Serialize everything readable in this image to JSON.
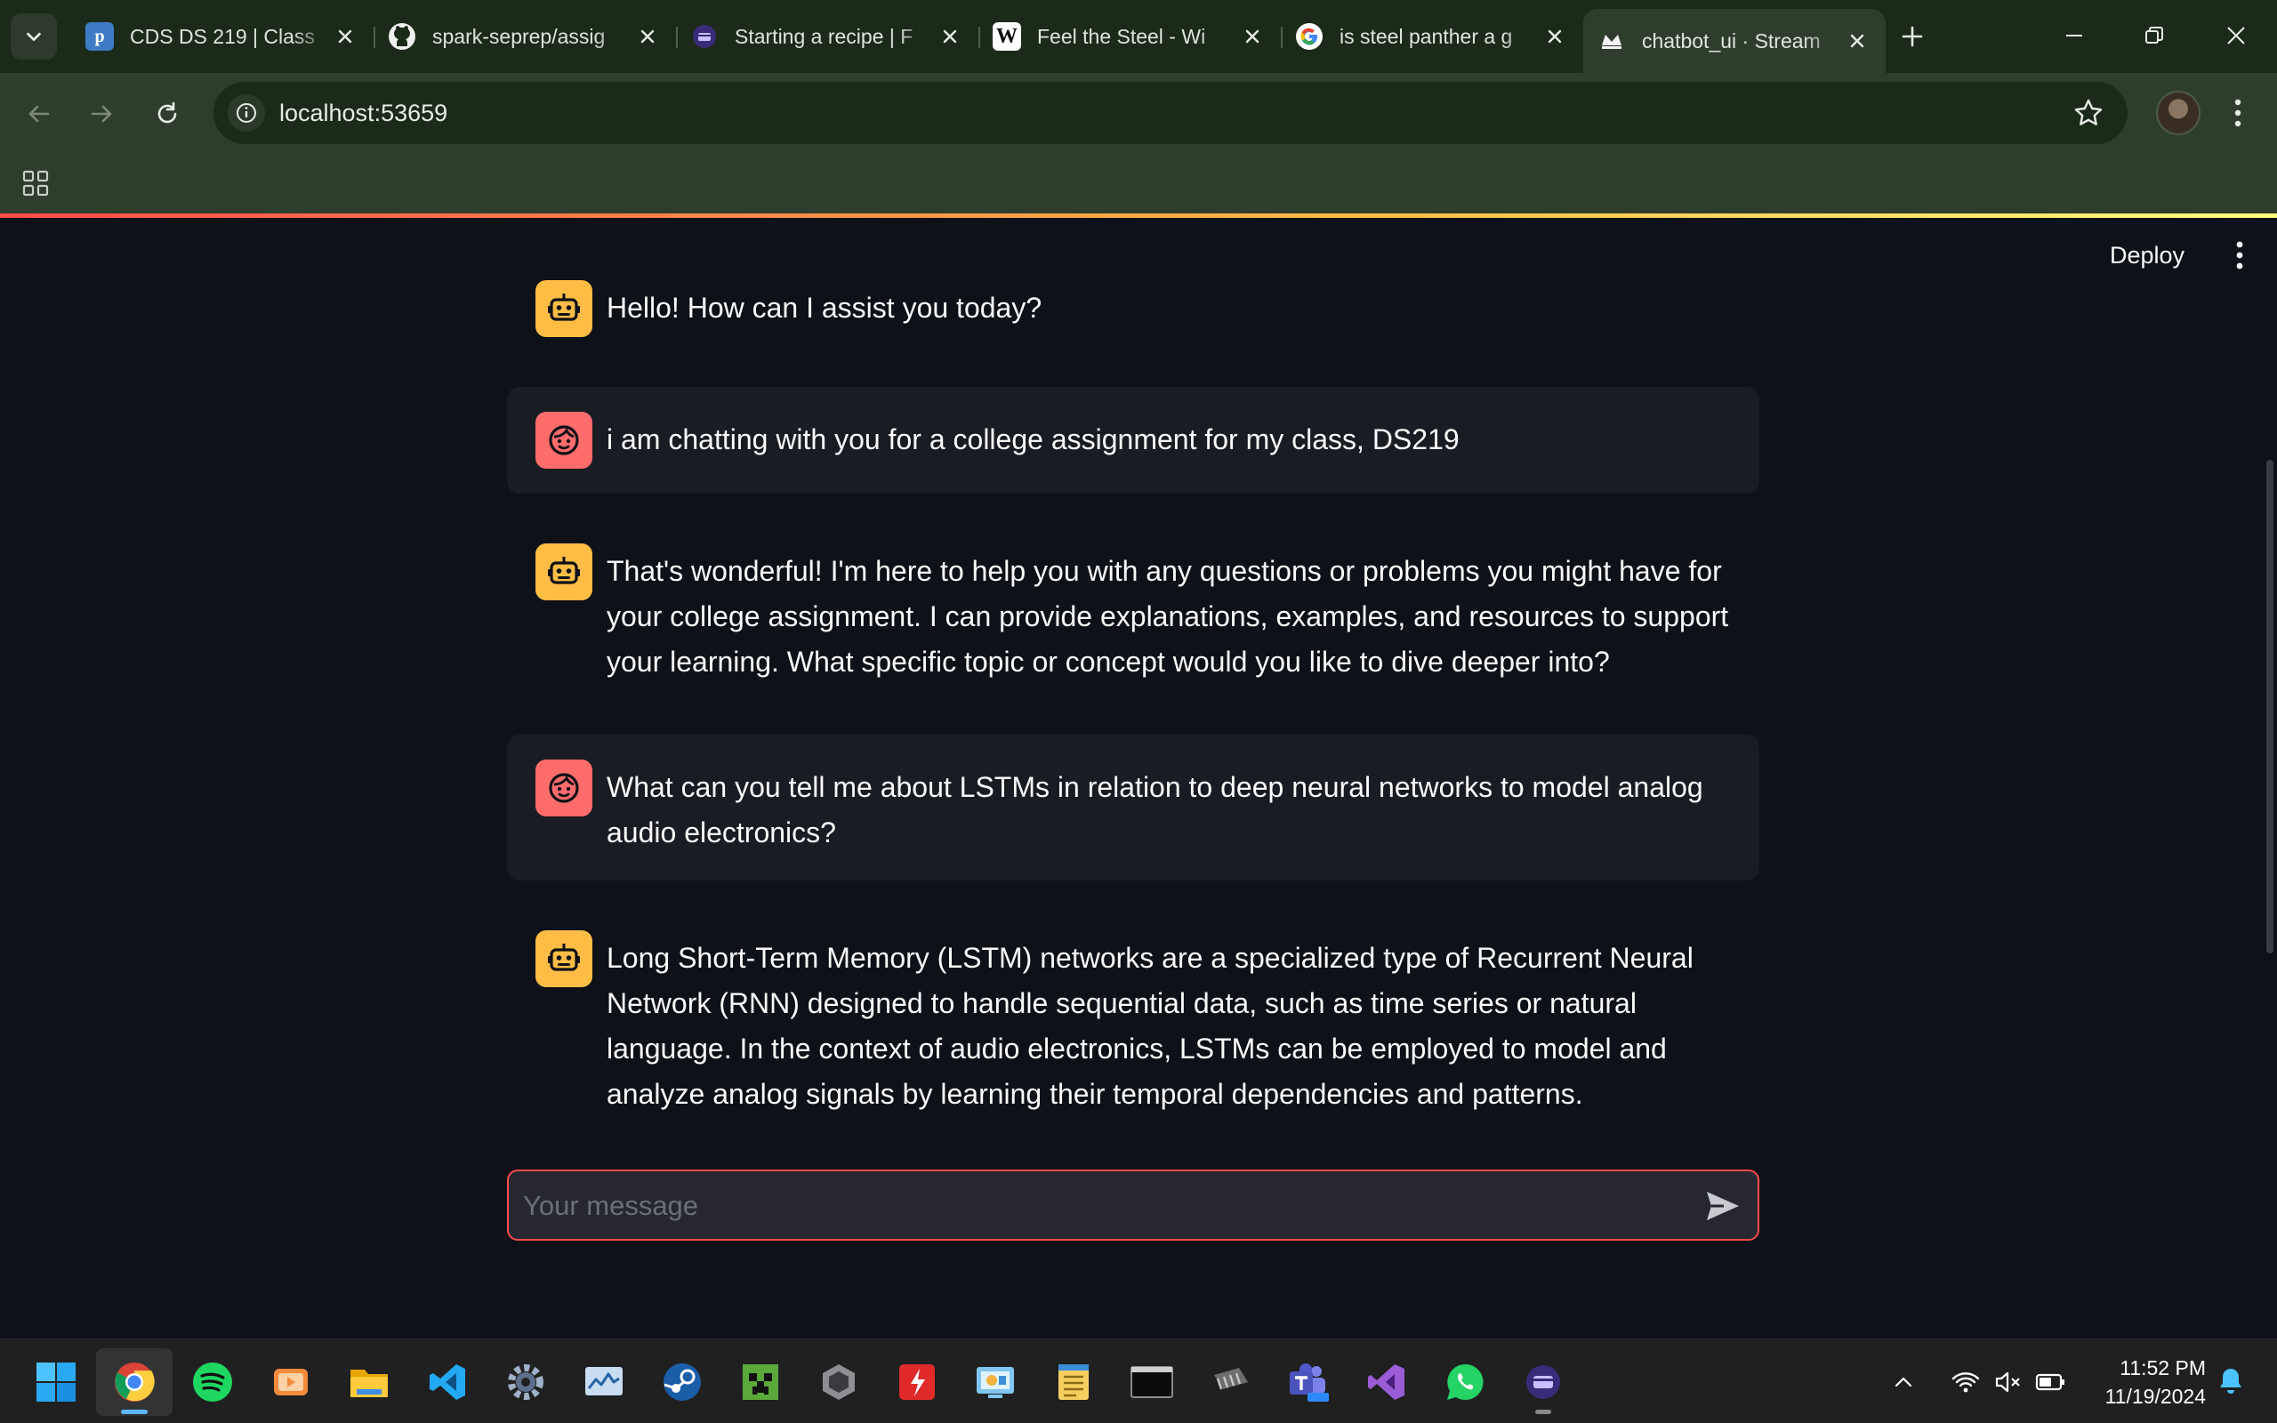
{
  "browser": {
    "tabs": [
      {
        "title": "CDS DS 219 | Class",
        "favicon": "piazza-icon"
      },
      {
        "title": "spark-seprep/assig",
        "favicon": "github-icon"
      },
      {
        "title": "Starting a recipe | F",
        "favicon": "recipe-icon"
      },
      {
        "title": "Feel the Steel - Wi",
        "favicon": "wikipedia-icon"
      },
      {
        "title": "is steel panther a g",
        "favicon": "google-icon"
      },
      {
        "title": "chatbot_ui · Stream",
        "favicon": "streamlit-icon"
      }
    ],
    "active_tab_index": 5,
    "url": "localhost:53659",
    "favicon_glyphs": {
      "piazza": "p",
      "wikipedia": "W"
    }
  },
  "app": {
    "deploy_label": "Deploy",
    "messages": [
      {
        "role": "assistant",
        "text": "Hello! How can I assist you today?"
      },
      {
        "role": "user",
        "text": "i am chatting with you for a college assignment for my class, DS219"
      },
      {
        "role": "assistant",
        "text": "That's wonderful! I'm here to help you with any questions or problems you might have for your college assignment. I can provide explanations, examples, and resources to support your learning. What specific topic or concept would you like to dive deeper into?"
      },
      {
        "role": "user",
        "text": "What can you tell me about LSTMs in relation to deep neural networks to model analog audio electronics?"
      },
      {
        "role": "assistant",
        "text": "Long Short-Term Memory (LSTM) networks are a specialized type of Recurrent Neural Network (RNN) designed to handle sequential data, such as time series or natural language. In the context of audio electronics, LSTMs can be employed to model and analyze analog signals by learning their temporal dependencies and patterns."
      }
    ],
    "input": {
      "placeholder": "Your message",
      "value": ""
    }
  },
  "taskbar": {
    "apps": [
      "windows-start",
      "chrome",
      "spotify",
      "media-player",
      "file-explorer",
      "vscode",
      "settings",
      "resource-monitor",
      "steam",
      "minecraft",
      "unity",
      "acrobat",
      "control-panel",
      "notepad",
      "terminal",
      "chip-tool",
      "teams",
      "visual-studio",
      "whatsapp",
      "recipe-app"
    ],
    "time": "11:52 PM",
    "date": "11/19/2024"
  },
  "colors": {
    "chrome_frame": "#1c2a1a",
    "chrome_toolbar": "#2f3d2d",
    "app_bg": "#0e1117",
    "user_bubble": "#1a1c24",
    "bot_avatar": "#ffbd45",
    "user_avatar": "#ff6c6c",
    "accent": "#ff4b4b"
  }
}
